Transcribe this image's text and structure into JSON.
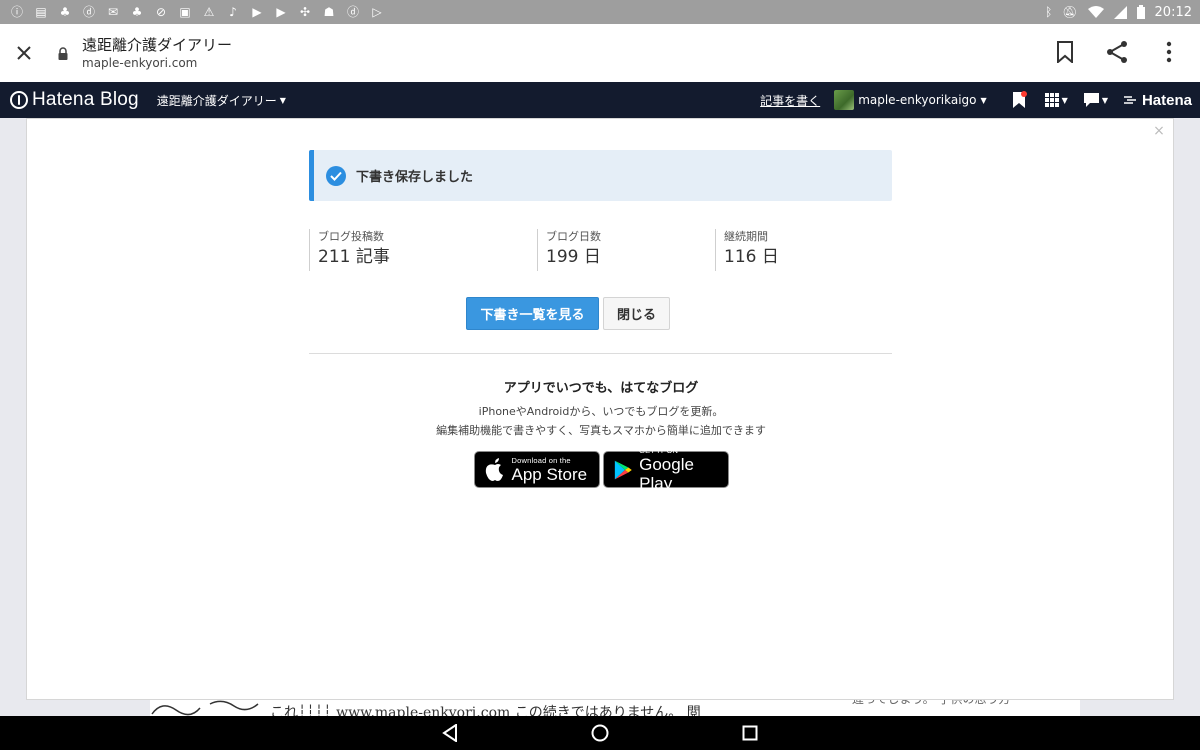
{
  "status_bar": {
    "time": "20:12",
    "left_icons": [
      "info-icon",
      "news-icon",
      "leaf-icon",
      "d-app-icon",
      "mail-icon",
      "leaf-icon",
      "wifi-off-icon",
      "image-icon",
      "warning-icon",
      "music-icon",
      "youtube-icon",
      "youtube-icon",
      "pinwheel-icon",
      "contact-icon",
      "d-app-icon",
      "play-store-icon"
    ],
    "right_icons": [
      "bluetooth-icon",
      "notifications-off-icon",
      "wifi-icon",
      "signal-icon",
      "battery-icon"
    ]
  },
  "browser": {
    "page_title": "遠距離介護ダイアリー",
    "url": "maple-enkyori.com"
  },
  "hatena_nav": {
    "logo_text": "Hatena Blog",
    "blog_name": "遠距離介護ダイアリー",
    "write_link": "記事を書く",
    "username": "maple-enkyorikaigo",
    "brand": "Hatena"
  },
  "modal": {
    "close_symbol": "×",
    "notice": "下書き保存しました",
    "stats": [
      {
        "label": "ブログ投稿数",
        "value": "211 記事"
      },
      {
        "label": "ブログ日数",
        "value": "199 日"
      },
      {
        "label": "継続期間",
        "value": "116 日"
      }
    ],
    "primary_button": "下書き一覧を見る",
    "secondary_button": "閉じる",
    "promo_title": "アプリでいつでも、はてなブログ",
    "promo_line1": "iPhoneやAndroidから、いつでもブログを更新。",
    "promo_line2": "編集補助機能で書きやすく、写真もスマホから簡単に追加できます",
    "app_store": {
      "small": "Download on the",
      "big": "App Store"
    },
    "google_play": {
      "small": "GET IT ON",
      "big": "Google Play"
    }
  },
  "background": {
    "text_left": "これ┆┆┆┆ www.maple-enkyori.com この続きではありません。 閲",
    "text_right": "違ってしまう。 子供の思う方"
  },
  "colors": {
    "accent": "#3a97e0",
    "nav_bg": "#131b2e",
    "notice_bg": "#e5eef7"
  }
}
